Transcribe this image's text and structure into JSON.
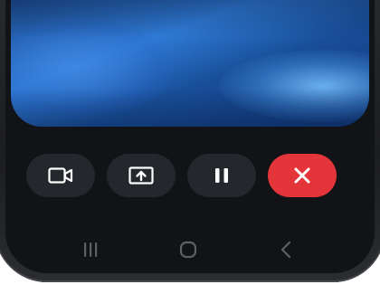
{
  "screen": {
    "preview": {
      "content": "video-preview"
    }
  },
  "call_controls": {
    "buttons": [
      {
        "icon": "video-camera-icon"
      },
      {
        "icon": "screen-share-icon"
      },
      {
        "icon": "pause-icon"
      },
      {
        "icon": "close-icon",
        "color": "#e4363a"
      }
    ]
  },
  "navigation_bar": {
    "buttons": [
      {
        "icon": "recent-apps-icon"
      },
      {
        "icon": "home-icon"
      },
      {
        "icon": "back-icon"
      }
    ]
  },
  "colors": {
    "end_call": "#e4363a",
    "control_bg": "#24272c",
    "icon": "#ffffff",
    "nav_icon": "#5c5f65"
  }
}
